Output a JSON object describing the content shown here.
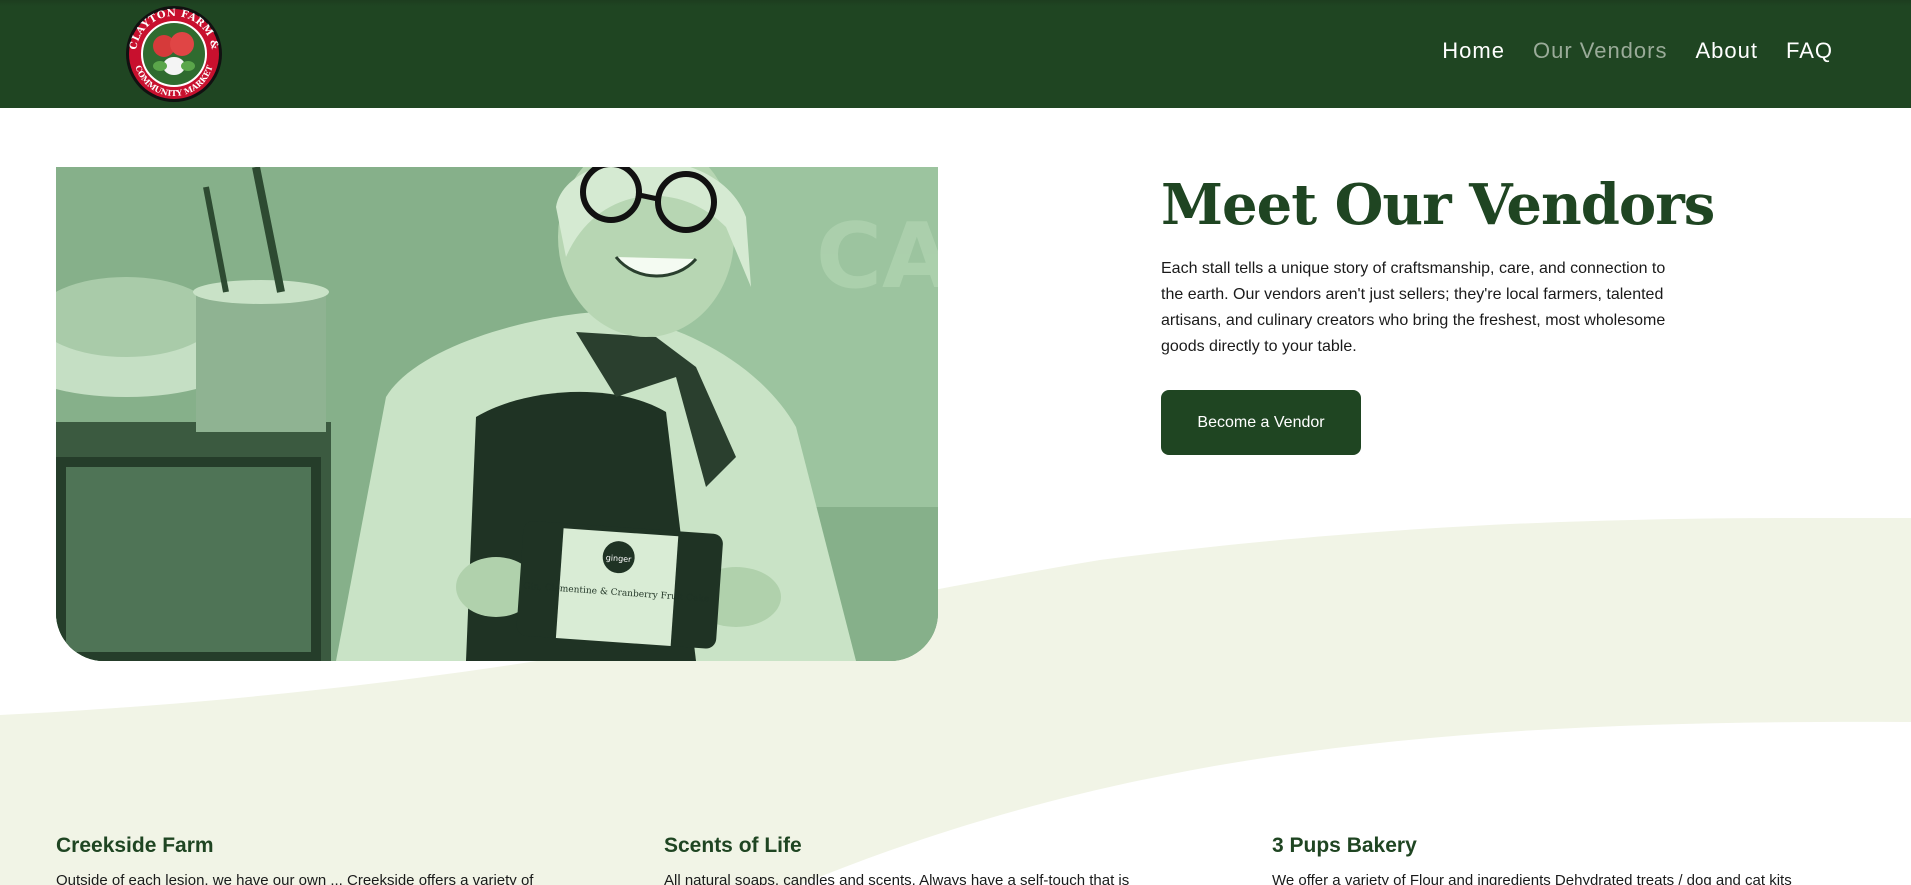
{
  "header": {
    "logo_text_top": "CLAYTON FARM &",
    "logo_text_bottom": "COMMUNITY MARKET",
    "nav": [
      {
        "label": "Home",
        "active": false
      },
      {
        "label": "Our Vendors",
        "active": true
      },
      {
        "label": "About",
        "active": false
      },
      {
        "label": "FAQ",
        "active": false
      }
    ]
  },
  "hero": {
    "title": "Meet Our Vendors",
    "description": "Each stall tells a unique story of craftsmanship, care, and connection to the earth. Our vendors aren't just sellers; they're local farmers, talented artisans, and culinary creators who bring the freshest, most wholesome goods directly to your table.",
    "cta_label": "Become a Vendor",
    "image_alt": "Smiling vendor holding a fruit cake",
    "product_brand": "ginger",
    "product_label": "Gin, Clementine & Cranberry Fruit Cake"
  },
  "vendors": [
    {
      "name": "Creekside Farm",
      "blurb": "Outside of each lesion, we have our own ... Creekside offers a variety of"
    },
    {
      "name": "Scents of Life",
      "blurb": "All natural soaps, candles and scents. Always have a self-touch that is"
    },
    {
      "name": "3 Pups Bakery",
      "blurb": "We offer a variety of Flour and ingredients Dehydrated treats / dog and cat kits"
    }
  ],
  "colors": {
    "brand_green": "#1f4522",
    "nav_active": "#9aab99",
    "wave": "#f1f4e6"
  }
}
